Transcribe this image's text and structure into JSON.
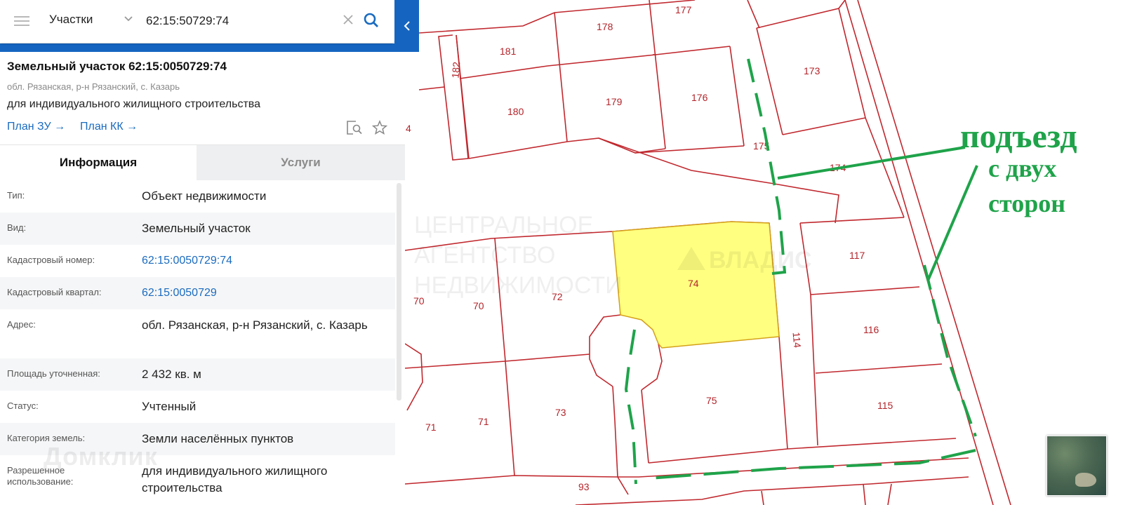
{
  "search": {
    "layer_label": "Участки",
    "query": "62:15:50729:74"
  },
  "panel": {
    "title": "Земельный участок 62:15:0050729:74",
    "address": "обл. Рязанская, р-н Рязанский, с. Казарь",
    "permitted_use": "для индивидуального жилищного строительства",
    "links": [
      "План ЗУ →",
      "План КК →"
    ],
    "tabs": [
      "Информация",
      "Услуги"
    ],
    "rows": [
      {
        "label": "Тип:",
        "value": "Объект недвижимости"
      },
      {
        "label": "Вид:",
        "value": "Земельный участок"
      },
      {
        "label": "Кадастровый номер:",
        "value": "62:15:0050729:74"
      },
      {
        "label": "Кадастровый квартал:",
        "value": "62:15:0050729"
      },
      {
        "label": "Адрес:",
        "value": "обл. Рязанская, р-н Рязанский, с. Казарь"
      },
      {
        "label": "Площадь уточненная:",
        "value": "2 432 кв. м"
      },
      {
        "label": "Статус:",
        "value": "Учтенный"
      },
      {
        "label": "Категория земель:",
        "value": "Земли населённых пунктов"
      },
      {
        "label": "Разрешенное использование:",
        "value": "для индивидуального жилищного строительства"
      }
    ],
    "watermark": "Домклик"
  },
  "map": {
    "plot_numbers": [
      "177",
      "178",
      "181",
      "182",
      "173",
      "180",
      "179",
      "176",
      "175",
      "174",
      "4",
      "117",
      "74",
      "70",
      "70",
      "72",
      "114",
      "116",
      "115",
      "75",
      "71",
      "71",
      "73",
      "93"
    ],
    "annotation_lines": [
      "подъезд",
      "с двух",
      "сторон"
    ],
    "watermark_lines": [
      "ЦЕНТРАЛЬНОЕ",
      "АГЕНТСТВО",
      "НЕДВИЖИМОСТИ",
      "ВЛАДИС"
    ],
    "colors": {
      "boundary": "#c0282e",
      "selected_plot": "#ffff80",
      "annotation": "#1fa34a",
      "accent": "#1565c0"
    }
  }
}
